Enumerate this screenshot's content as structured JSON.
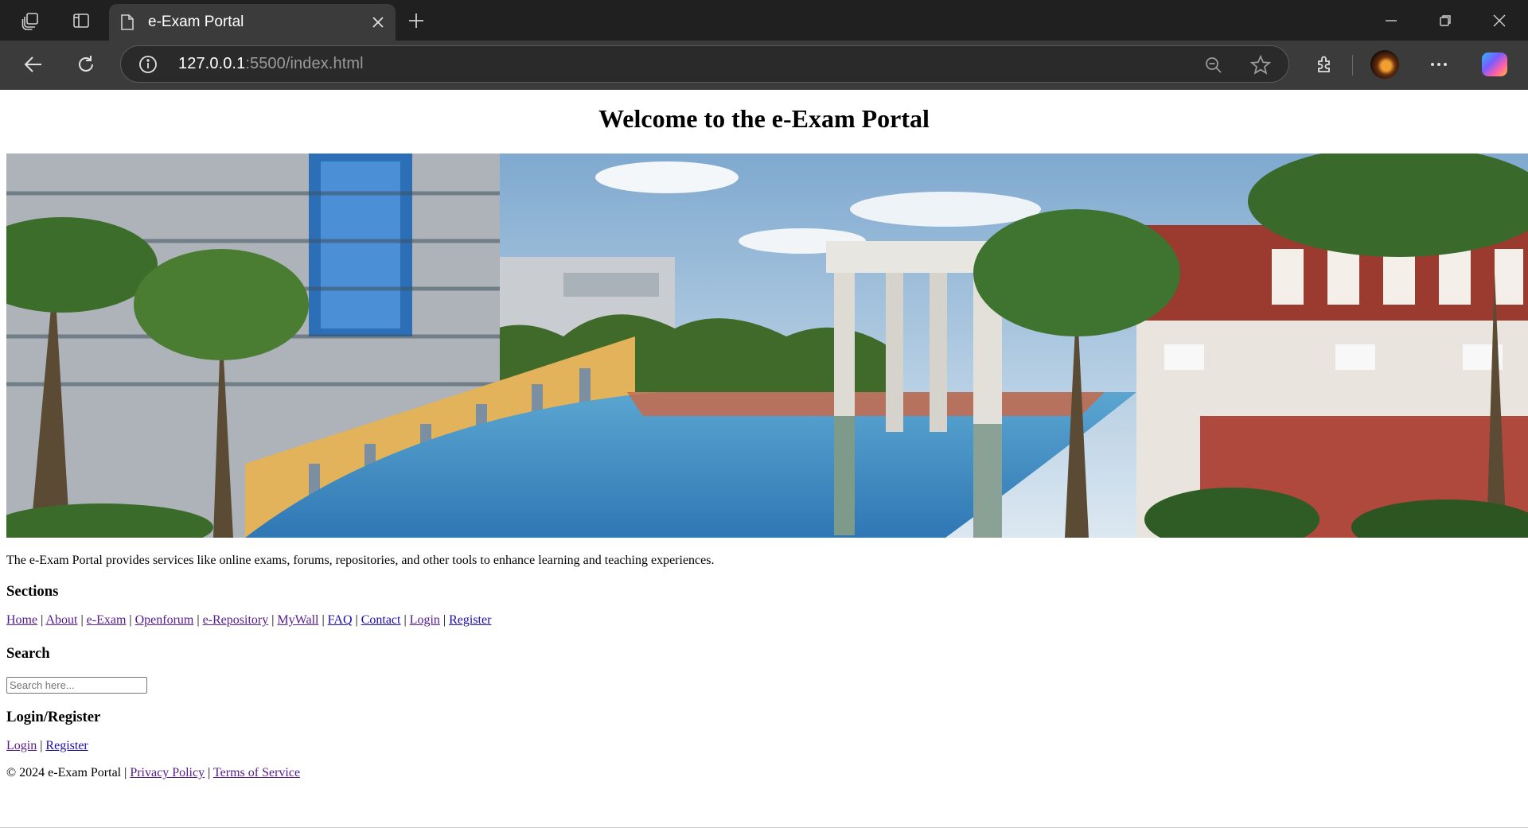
{
  "browser": {
    "tab_title": "e-Exam Portal",
    "url_host": "127.0.0.1",
    "url_rest": ":5500/index.html"
  },
  "page": {
    "heading": "Welcome to the e-Exam Portal",
    "intro": "The e-Exam Portal provides services like online exams, forums, repositories, and other tools to enhance learning and teaching experiences.",
    "sections_heading": "Sections",
    "section_links": [
      "Home",
      "About",
      "e-Exam",
      "Openforum",
      "e-Repository",
      "MyWall",
      "FAQ",
      "Contact",
      "Login",
      "Register"
    ],
    "search_heading": "Search",
    "search_placeholder": "Search here...",
    "login_heading": "Login/Register",
    "login_link": "Login",
    "register_link": "Register",
    "copyright": "© 2024 e-Exam Portal |",
    "privacy_link": "Privacy Policy",
    "terms_link": "Terms of Service",
    "separator": "|"
  }
}
